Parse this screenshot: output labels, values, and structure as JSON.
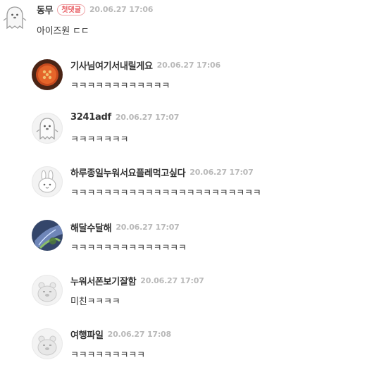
{
  "comments": [
    {
      "nickname": "동무",
      "badge": "첫댓글",
      "timestamp": "20.06.27 17:06",
      "text": "아이즈원 ㄷㄷ",
      "avatar": "ghost-default-icon"
    }
  ],
  "replies": [
    {
      "nickname": "기사님여기서내릴게요",
      "timestamp": "20.06.27 17:06",
      "text": "ㅋㅋㅋㅋㅋㅋㅋㅋㅋㅋㅋㅋ",
      "avatar": "orange-button-photo"
    },
    {
      "nickname": "3241adf",
      "timestamp": "20.06.27 17:07",
      "text": "ㅋㅋㅋㅋㅋㅋㅋ",
      "avatar": "ghost-default-icon"
    },
    {
      "nickname": "하루종일누워서요플레먹고싶다",
      "timestamp": "20.06.27 17:07",
      "text": "ㅋㅋㅋㅋㅋㅋㅋㅋㅋㅋㅋㅋㅋㅋㅋㅋㅋㅋㅋㅋㅋㅋㅋ",
      "avatar": "bunny-default-icon"
    },
    {
      "nickname": "해달수달해",
      "timestamp": "20.06.27 17:07",
      "text": "ㅋㅋㅋㅋㅋㅋㅋㅋㅋㅋㅋㅋㅋㅋ",
      "avatar": "blue-leaf-photo"
    },
    {
      "nickname": "누워서폰보기잘함",
      "timestamp": "20.06.27 17:07",
      "text": "미친ㅋㅋㅋㅋ",
      "avatar": "bear-default-icon"
    },
    {
      "nickname": "여행파일",
      "timestamp": "20.06.27 17:08",
      "text": "ㅋㅋㅋㅋㅋㅋㅋㅋㅋ",
      "avatar": "bear-default-icon"
    }
  ],
  "colors": {
    "badge": "#e85a60",
    "timestamp": "#b9b9b9",
    "nickname": "#333333"
  }
}
